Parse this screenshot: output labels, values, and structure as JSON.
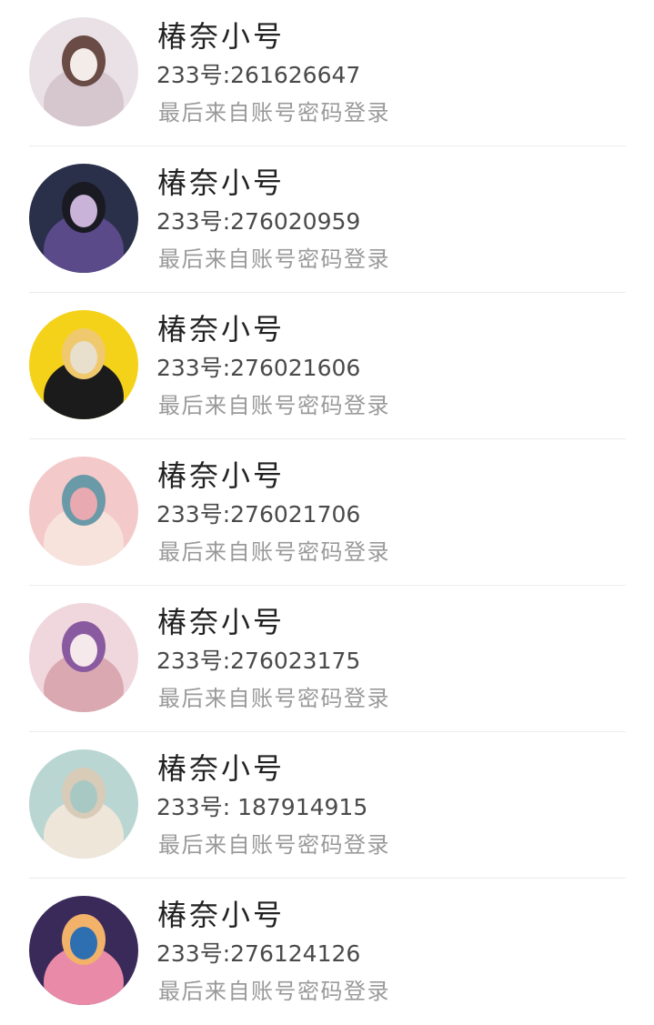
{
  "accounts": [
    {
      "nickname": "椿奈小号",
      "uid_line": "233号:261626647",
      "last_login": "最后来自账号密码登录",
      "avatar_colors": [
        "#e9e1e6",
        "#d6c7cf",
        "#6a4b45",
        "#f3ece9"
      ]
    },
    {
      "nickname": "椿奈小号",
      "uid_line": "233号:276020959",
      "last_login": "最后来自账号密码登录",
      "avatar_colors": [
        "#2a2f4a",
        "#5a4a8a",
        "#1a1a22",
        "#c9b3d8"
      ]
    },
    {
      "nickname": "椿奈小号",
      "uid_line": "233号:276021606",
      "last_login": "最后来自账号密码登录",
      "avatar_colors": [
        "#f5d21a",
        "#1b1b1b",
        "#f0c96e",
        "#e8e0cc"
      ]
    },
    {
      "nickname": "椿奈小号",
      "uid_line": "233号:276021706",
      "last_login": "最后来自账号密码登录",
      "avatar_colors": [
        "#f4c9c9",
        "#f7e2dc",
        "#6a9aa8",
        "#e9a9b0"
      ]
    },
    {
      "nickname": "椿奈小号",
      "uid_line": "233号:276023175",
      "last_login": "最后来自账号密码登录",
      "avatar_colors": [
        "#f0d7dd",
        "#d9a8b0",
        "#8a5aa0",
        "#f6e9ec"
      ]
    },
    {
      "nickname": "椿奈小号",
      "uid_line": "233号: 187914915",
      "last_login": "最后来自账号密码登录",
      "avatar_colors": [
        "#b9d6d3",
        "#efe6da",
        "#d8cbb8",
        "#a8c8c4"
      ]
    },
    {
      "nickname": "椿奈小号",
      "uid_line": "233号:276124126",
      "last_login": "最后来自账号密码登录",
      "avatar_colors": [
        "#3a2a5a",
        "#e98aa8",
        "#f2b26a",
        "#2d6fb0"
      ]
    }
  ]
}
